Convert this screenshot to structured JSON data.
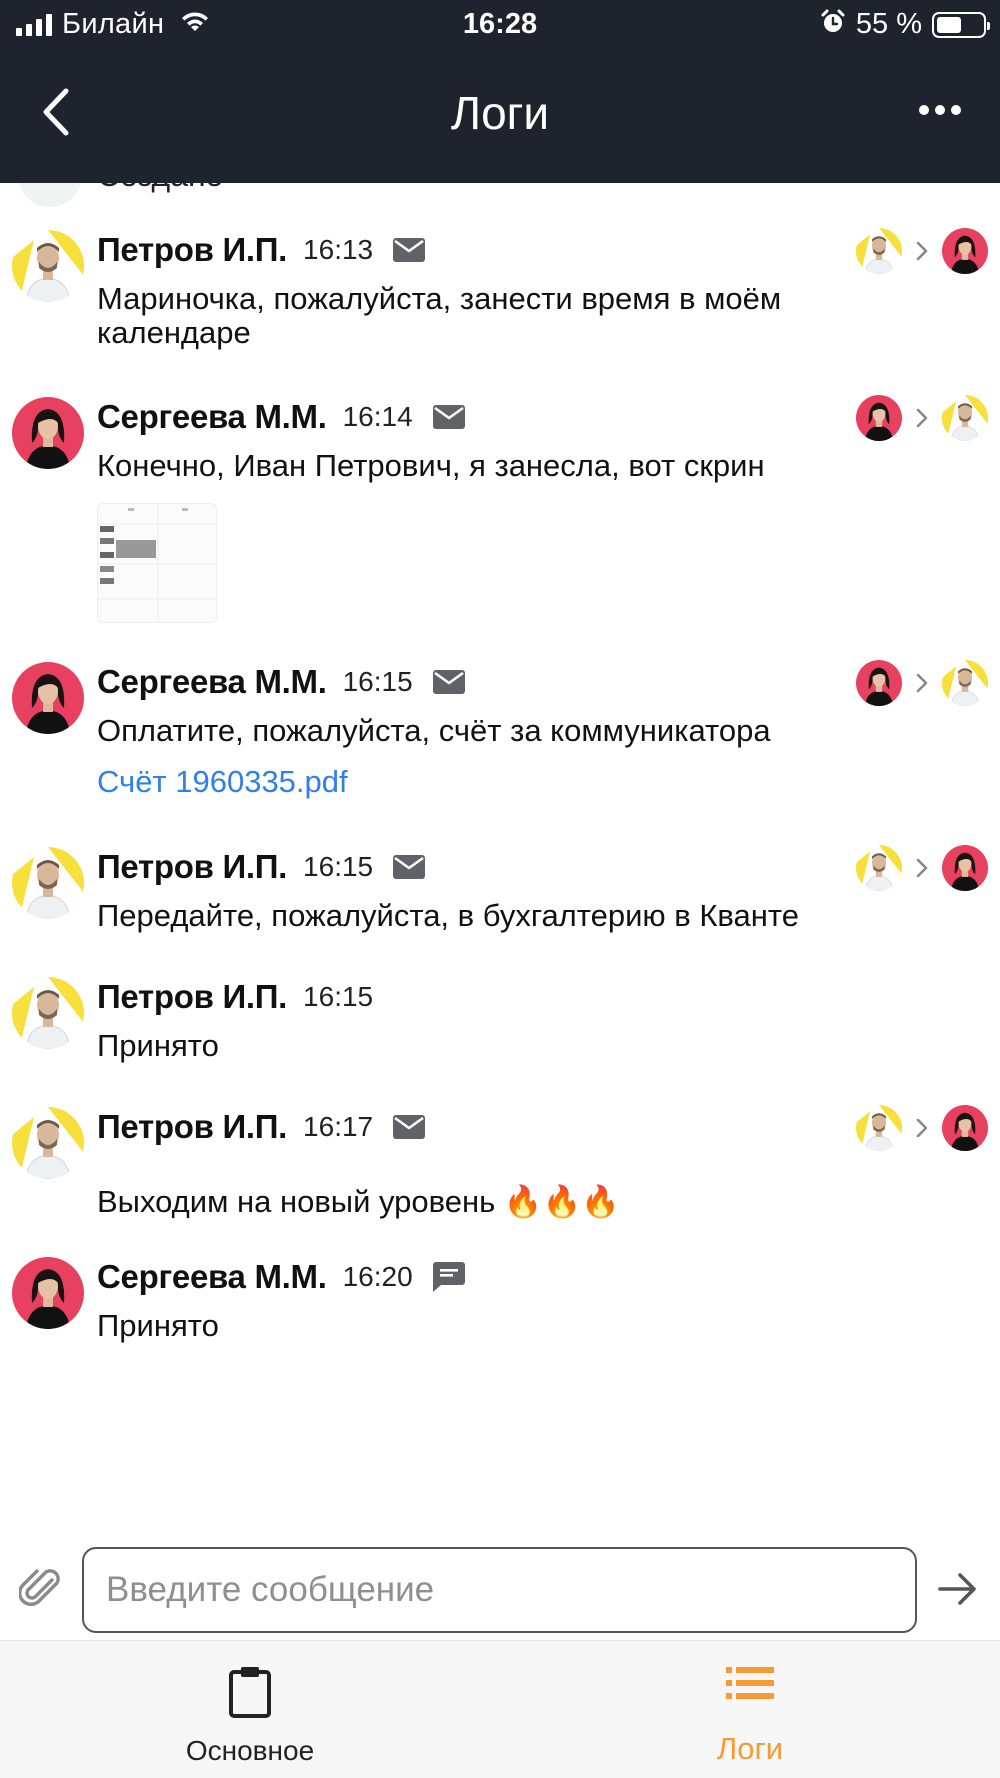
{
  "status_bar": {
    "carrier": "Билайн",
    "time": "16:28",
    "battery_percent": "55 %",
    "battery_level": 0.55,
    "icons": [
      "signal-icon",
      "wifi-icon",
      "alarm-icon",
      "battery-icon"
    ]
  },
  "nav": {
    "title": "Логи",
    "back_icon": "chevron-left-icon",
    "more_icon": "more-icon"
  },
  "partial_text": "Создано",
  "messages": [
    {
      "author": "Петров И.П.",
      "time": "16:13",
      "kind": "mail",
      "text": "Мариночка, пожалуйста, занести время в моём календаре",
      "from": "petrov",
      "to": "sergeeva"
    },
    {
      "author": "Сергеева М.М.",
      "time": "16:14",
      "kind": "mail",
      "text": "Конечно, Иван Петрович, я занесла, вот скрин",
      "from": "sergeeva",
      "to": "petrov",
      "has_image": true
    },
    {
      "author": "Сергеева М.М.",
      "time": "16:15",
      "kind": "mail",
      "text": "Оплатите, пожалуйста, счёт за коммуникатора",
      "link": "Счёт 1960335.pdf",
      "from": "sergeeva",
      "to": "petrov"
    },
    {
      "author": "Петров И.П.",
      "time": "16:15",
      "kind": "mail",
      "text": "Передайте, пожалуйста, в бухгалтерию в Кванте",
      "from": "petrov",
      "to": "sergeeva"
    },
    {
      "author": "Петров И.П.",
      "time": "16:15",
      "kind": "none",
      "text": "Принято",
      "from": "petrov"
    },
    {
      "author": "Петров И.П.",
      "time": "16:17",
      "kind": "mail",
      "text": "Выходим на новый уровень 🔥🔥🔥",
      "from": "petrov",
      "to": "sergeeva"
    },
    {
      "author": "Сергеева М.М.",
      "time": "16:20",
      "kind": "chat",
      "text": "Принято",
      "from": "sergeeva"
    }
  ],
  "composer": {
    "placeholder": "Введите сообщение",
    "attach_icon": "paperclip-icon",
    "send_icon": "arrow-right-icon"
  },
  "tabs": [
    {
      "label": "Основное",
      "icon": "clipboard-icon",
      "active": false
    },
    {
      "label": "Логи",
      "icon": "list-icon",
      "active": true
    }
  ],
  "colors": {
    "header_bg": "#1f232d",
    "accent": "#f59b36",
    "link": "#2f80ed",
    "petrov_avatar_bg": "#f7df3c",
    "sergeeva_avatar_bg": "#e8405f"
  }
}
